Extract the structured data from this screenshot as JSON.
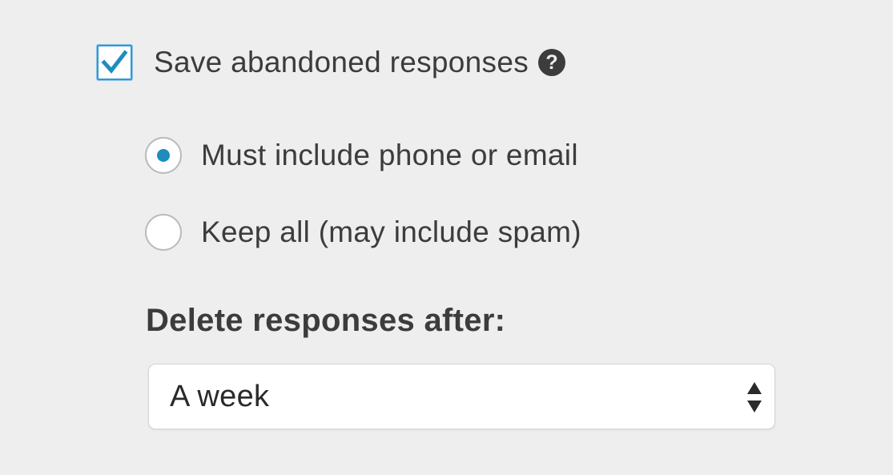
{
  "abandoned": {
    "checked": true,
    "label": "Save abandoned responses",
    "help_icon": "question-circle-icon",
    "help_glyph": "?"
  },
  "filter_options": [
    {
      "label": "Must include phone or email",
      "selected": true
    },
    {
      "label": "Keep all (may include spam)",
      "selected": false
    }
  ],
  "delete_after": {
    "heading": "Delete responses after:",
    "selected_value": "A week"
  },
  "colors": {
    "accent": "#1e8cbe",
    "checkbox_border": "#2f9ad6",
    "background": "#eeeeee",
    "text": "#3c3c3c"
  }
}
